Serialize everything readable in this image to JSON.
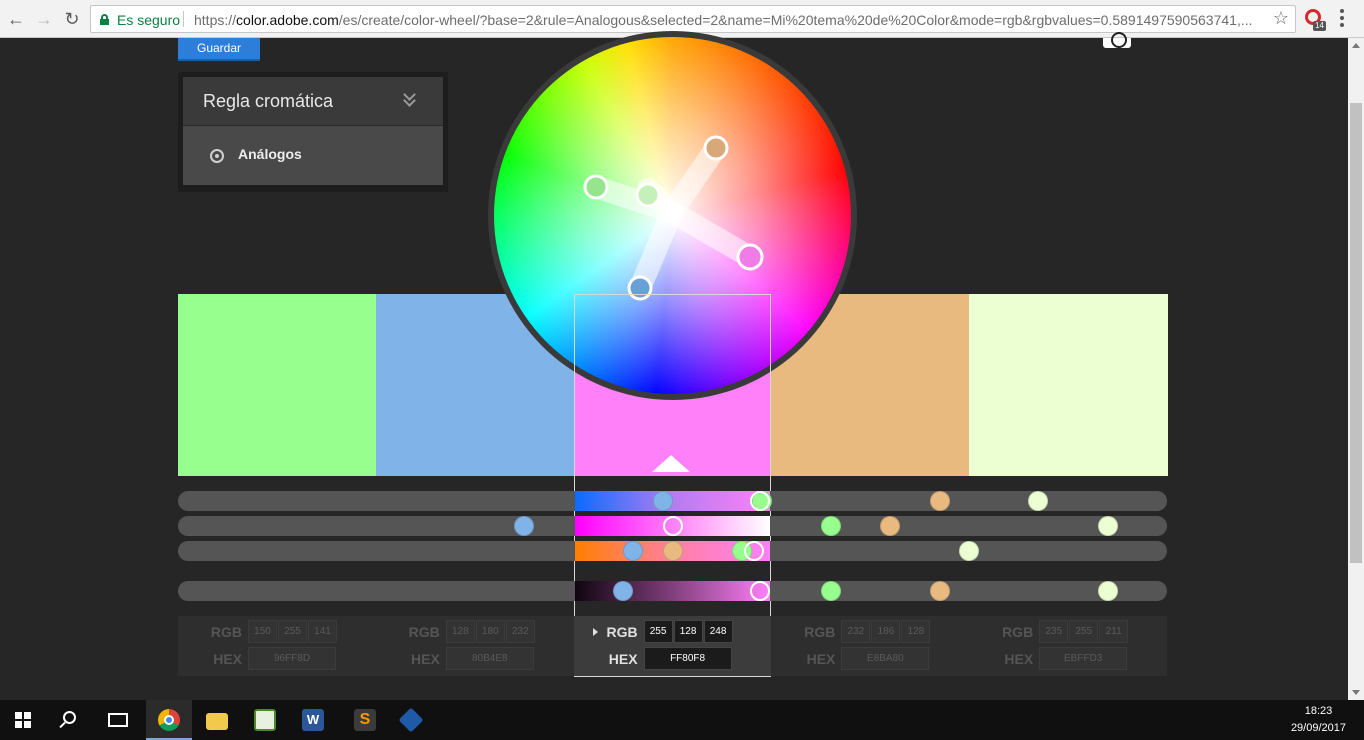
{
  "browser": {
    "secure_label": "Es seguro",
    "url_prefix": "https://",
    "url_domain": "color.adobe.com",
    "url_rest": "/es/create/color-wheel/?base=2&rule=Analogous&selected=2&name=Mi%20tema%20de%20Color&mode=rgb&rgbvalues=0.5891497590563741,...",
    "extension_badge": "14"
  },
  "toolbar": {
    "save_label": "Guardar"
  },
  "rule_panel": {
    "title": "Regla cromática",
    "selected_rule": "Análogos"
  },
  "palette": {
    "selected_index": 2,
    "colors": [
      {
        "hex": "#96FF8D",
        "rgb": [
          "150",
          "255",
          "141"
        ],
        "hex_label": "96FF8D",
        "sliders": [
          0.59,
          0.66,
          0.57,
          0.66
        ]
      },
      {
        "hex": "#80B4E8",
        "rgb": [
          "128",
          "180",
          "232"
        ],
        "hex_label": "80B4E8",
        "sliders": [
          0.49,
          0.35,
          0.46,
          0.45
        ]
      },
      {
        "hex": "#FF80F8",
        "rgb": [
          "255",
          "128",
          "248"
        ],
        "hex_label": "FF80F8",
        "sliders": [
          0.95,
          0.5,
          0.92,
          0.95
        ]
      },
      {
        "hex": "#E8BA80",
        "rgb": [
          "232",
          "186",
          "128"
        ],
        "hex_label": "E8BA80",
        "sliders": [
          0.77,
          0.72,
          0.5,
          0.77
        ]
      },
      {
        "hex": "#EBFFD3",
        "rgb": [
          "235",
          "255",
          "211"
        ],
        "hex_label": "EBFFD3",
        "sliders": [
          0.87,
          0.94,
          0.8,
          0.94
        ]
      }
    ]
  },
  "values_labels": {
    "rgb": "RGB",
    "hex": "HEX"
  },
  "taskbar": {
    "time": "18:23",
    "date": "29/09/2017",
    "apps": [
      "windows-start",
      "search",
      "task-view",
      "chrome",
      "file-explorer",
      "spreadsheet-app",
      "word",
      "sublime-text",
      "virtualbox"
    ]
  }
}
